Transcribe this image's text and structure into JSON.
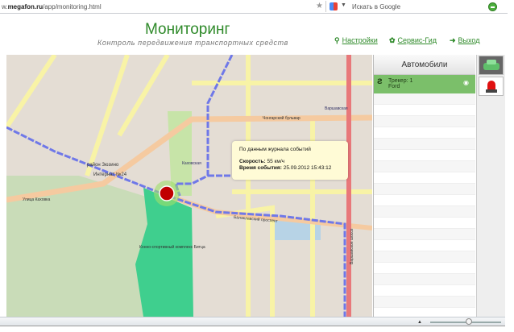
{
  "browser": {
    "url_domain": "megafon.ru",
    "url_prefix": "w.",
    "url_path": "/app/monitoring.html",
    "search_placeholder": "Искать в Google"
  },
  "header": {
    "title": "Мониторинг",
    "subtitle": "Контроль передвижения транспортных средств",
    "links": [
      {
        "label": "Настройки",
        "icon": "pin-icon"
      },
      {
        "label": "Сервис-Гид",
        "icon": "gear-icon"
      },
      {
        "label": "Выход",
        "icon": "exit-icon"
      }
    ]
  },
  "map": {
    "labels": {
      "zyuzino": "район Зюзино",
      "internat": "Интернат №24",
      "kakhovka_st": "Улица Каховка",
      "kakhovskaya": "Каховская",
      "chongar": "Чонгарский бульвар",
      "varshavskaya": "Варшавская",
      "varsh_shosse": "Варшавское шоссе",
      "balaklava": "Балаклавский проспект",
      "bitsa": "Конно-спортивный комплекс Битца",
      "vavilova": "Улица Каховка"
    },
    "popup": {
      "heading": "По данным журнала событий",
      "speed_label": "Скорость:",
      "speed_value": "55 км/ч",
      "time_label": "Время события:",
      "time_value": "25.09.2012 15:43:12"
    },
    "marker_color": "#c00000",
    "zoom_fraction": 0.55
  },
  "panel": {
    "title": "Автомобили",
    "vehicles": [
      {
        "line1": "Трекер: 1",
        "line2": "Ford",
        "selected": true
      }
    ]
  },
  "colors": {
    "accent": "#2f8a2a",
    "selected_row": "#7bbf6a"
  }
}
